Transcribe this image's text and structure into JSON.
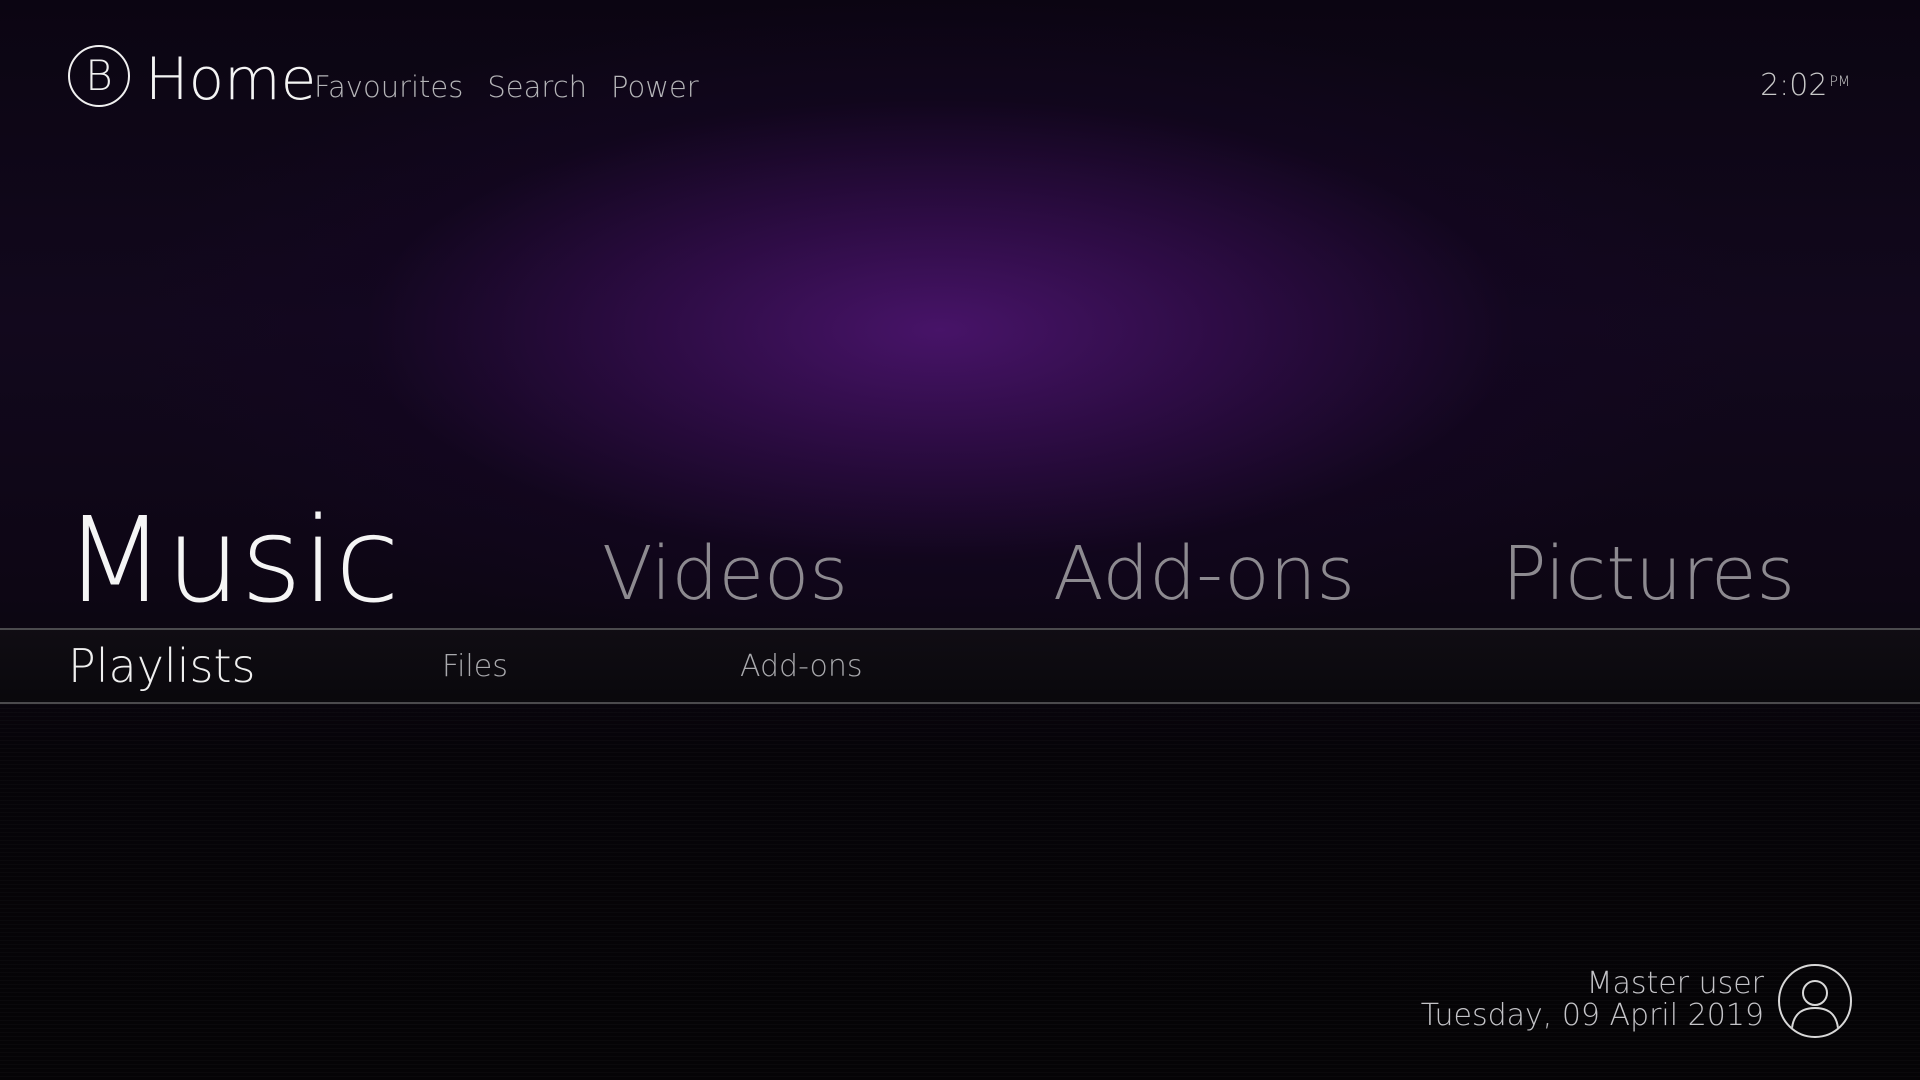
{
  "header": {
    "logo_letter": "B",
    "title": "Home",
    "links": [
      "Favourites",
      "Search",
      "Power"
    ]
  },
  "clock": {
    "time": "2:02",
    "ampm": "PM"
  },
  "main_menu": {
    "items": [
      "Music",
      "Videos",
      "Add-ons",
      "Pictures"
    ],
    "selected": "Music"
  },
  "sub_menu": {
    "items": [
      "Playlists",
      "Files",
      "Add-ons"
    ],
    "selected": "Playlists"
  },
  "user": {
    "name": "Master user",
    "date": "Tuesday, 09 April 2019"
  },
  "colors": {
    "accent_purple": "#4a146c",
    "background": "#050308",
    "text_primary": "#f5f5f5",
    "text_secondary": "#8d8a90"
  },
  "icons": {
    "logo": "circle-letter-logo",
    "avatar": "user-avatar-icon"
  }
}
